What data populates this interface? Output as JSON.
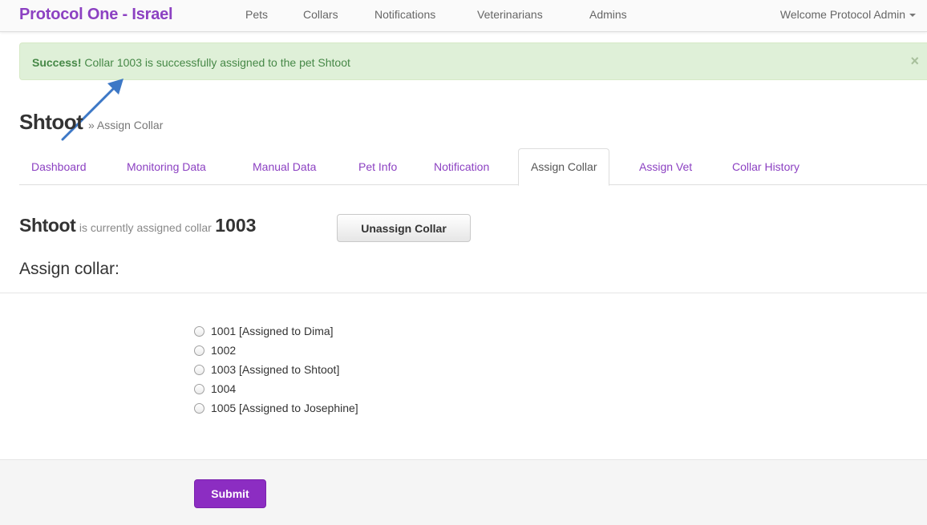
{
  "colors": {
    "brand": "#8c41c2",
    "success_bg": "#dff0d8",
    "success_text": "#468847",
    "submit": "#8c2dc2"
  },
  "navbar": {
    "brand": "Protocol One - Israel",
    "links": [
      "Pets",
      "Collars",
      "Notifications",
      "Veterinarians",
      "Admins"
    ],
    "welcome": "Welcome Protocol Admin",
    "welcome_icon": "caret-down-icon"
  },
  "alert": {
    "strong": "Success!",
    "message": " Collar 1003 is successfully assigned to the pet Shtoot",
    "close": "×"
  },
  "page": {
    "title": "Shtoot",
    "subtitle": "» Assign Collar"
  },
  "tabs": [
    {
      "label": "Dashboard",
      "active": false
    },
    {
      "label": "Monitoring Data",
      "active": false
    },
    {
      "label": "Manual Data",
      "active": false
    },
    {
      "label": "Pet Info",
      "active": false
    },
    {
      "label": "Notification",
      "active": false
    },
    {
      "label": "Assign Collar",
      "active": true
    },
    {
      "label": "Assign Vet",
      "active": false
    },
    {
      "label": "Collar History",
      "active": false
    }
  ],
  "status": {
    "pet": "Shtoot",
    "text": "is currently assigned collar",
    "collar": "1003",
    "unassign_label": "Unassign Collar"
  },
  "assign": {
    "heading": "Assign collar:",
    "options": [
      "1001 [Assigned to Dima]",
      "1002",
      "1003 [Assigned to Shtoot]",
      "1004",
      "1005 [Assigned to Josephine]"
    ],
    "submit_label": "Submit"
  }
}
